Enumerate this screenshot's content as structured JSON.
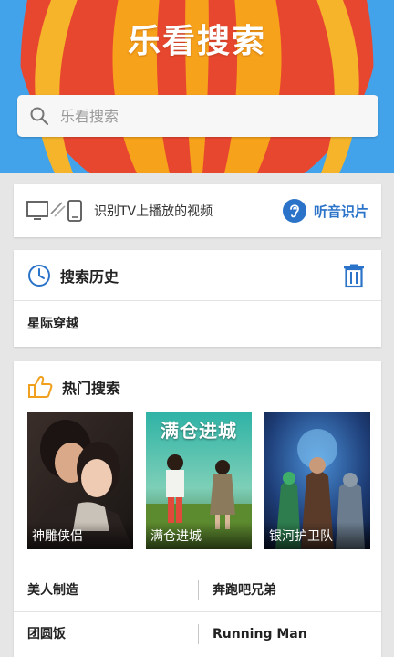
{
  "header": {
    "app_title": "乐看搜索",
    "search_placeholder": "乐看搜索",
    "colors": {
      "sky": "#43a3ea",
      "balloon_red": "#e8472f",
      "balloon_orange": "#f7a21b"
    }
  },
  "tv_recognition": {
    "icon": "tv-phone-cast-icon",
    "label": "识别TV上播放的视频",
    "listen_icon": "ear-icon",
    "listen_label": "听音识片"
  },
  "history": {
    "icon": "clock-icon",
    "title": "搜索历史",
    "clear_icon": "trash-icon",
    "items": [
      "星际穿越"
    ]
  },
  "hot_search": {
    "icon": "thumbs-up-icon",
    "title": "热门搜索",
    "posters": [
      {
        "caption": "神雕侠侣",
        "poster_title": ""
      },
      {
        "caption": "满仓进城",
        "poster_title": "满仓进城"
      },
      {
        "caption": "银河护卫队",
        "poster_title": ""
      }
    ],
    "links": [
      [
        "美人制造",
        "奔跑吧兄弟"
      ],
      [
        "团圆饭",
        "Running Man"
      ]
    ]
  },
  "accent_color": "#2a73c9"
}
